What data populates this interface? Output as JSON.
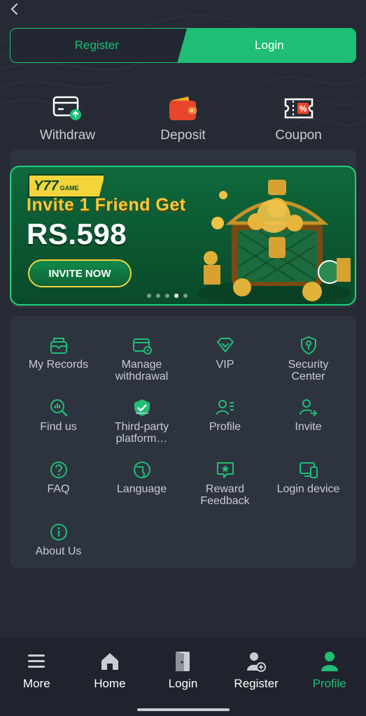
{
  "auth": {
    "register_label": "Register",
    "login_label": "Login",
    "active": "login"
  },
  "quick_actions": [
    {
      "label": "Withdraw",
      "icon": "withdraw-icon"
    },
    {
      "label": "Deposit",
      "icon": "wallet-icon"
    },
    {
      "label": "Coupon",
      "icon": "coupon-icon"
    }
  ],
  "banner": {
    "badge": "Y77",
    "badge_sub": "GAME",
    "title": "Invite 1 Friend Get",
    "amount": "RS.598",
    "button_label": "INVITE NOW",
    "slide_count": 5,
    "active_slide": 3
  },
  "menu": [
    {
      "label": "My Records",
      "icon": "records-icon"
    },
    {
      "label": "Manage withdrawal",
      "icon": "card-icon"
    },
    {
      "label": "VIP",
      "icon": "vip-diamond-icon"
    },
    {
      "label": "Security Center",
      "icon": "shield-key-icon"
    },
    {
      "label": "Find us",
      "icon": "search-chart-icon"
    },
    {
      "label": "Third-party platform…",
      "icon": "check-shield-icon"
    },
    {
      "label": "Profile",
      "icon": "profile-card-icon"
    },
    {
      "label": "Invite",
      "icon": "user-share-icon"
    },
    {
      "label": "FAQ",
      "icon": "question-icon"
    },
    {
      "label": "Language",
      "icon": "globe-icon"
    },
    {
      "label": "Reward Feedback",
      "icon": "star-message-icon"
    },
    {
      "label": "Login device",
      "icon": "devices-icon"
    },
    {
      "label": "About Us",
      "icon": "info-icon"
    }
  ],
  "bottom_nav": [
    {
      "label": "More",
      "icon": "menu-icon"
    },
    {
      "label": "Home",
      "icon": "home-icon"
    },
    {
      "label": "Login",
      "icon": "door-icon"
    },
    {
      "label": "Register",
      "icon": "add-user-icon"
    },
    {
      "label": "Profile",
      "icon": "user-icon"
    }
  ],
  "bottom_nav_active": "Profile",
  "colors": {
    "accent": "#1fbe75",
    "background": "#262a35",
    "card": "#2e3340",
    "nav": "#20232d"
  }
}
